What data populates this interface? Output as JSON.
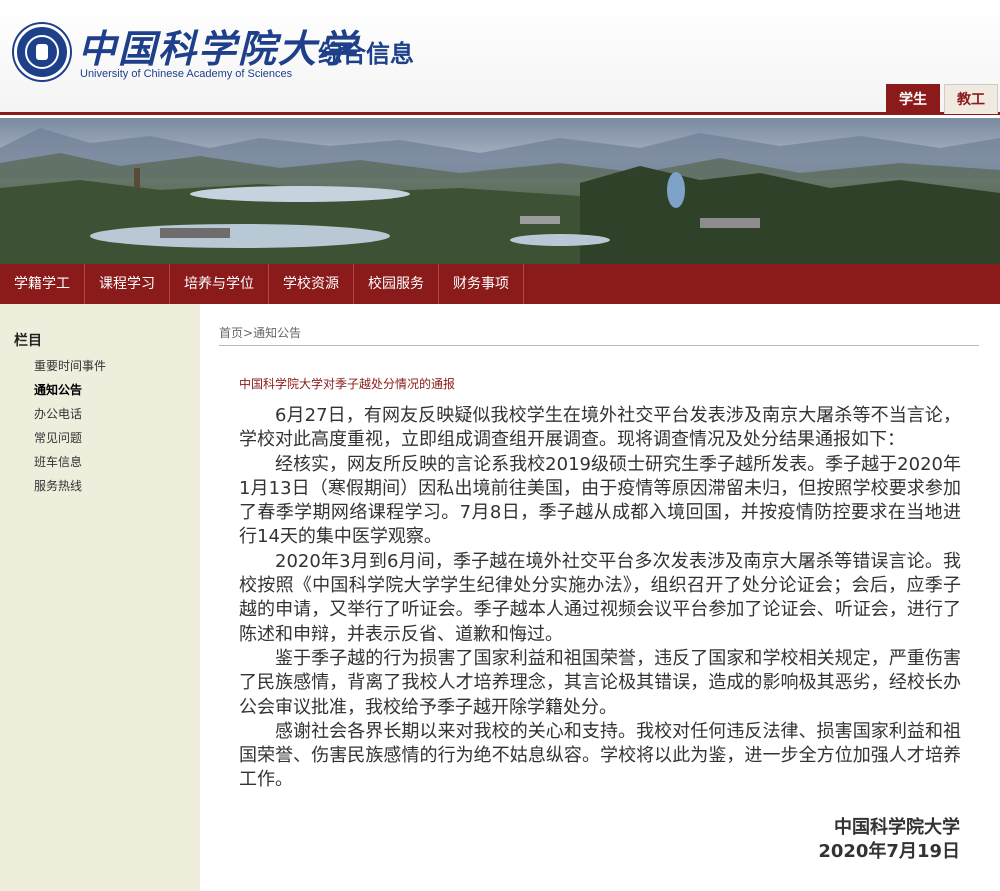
{
  "header": {
    "logo_cn": "中国科学院大学",
    "logo_en": "University of Chinese Academy of Sciences",
    "site_title": "综合信息",
    "role_tabs": [
      "学生",
      "教工"
    ]
  },
  "nav": {
    "items": [
      "学籍学工",
      "课程学习",
      "培养与学位",
      "学校资源",
      "校园服务",
      "财务事项"
    ]
  },
  "sidebar": {
    "title": "栏目",
    "items": [
      "重要时间事件",
      "通知公告",
      "办公电话",
      "常见问题",
      "班车信息",
      "服务热线"
    ],
    "current_item": "通知公告"
  },
  "breadcrumb": {
    "home": "首页",
    "separator": ">",
    "current": "通知公告"
  },
  "article": {
    "title": "中国科学院大学对季子越处分情况的通报",
    "paragraphs": [
      "6月27日，有网友反映疑似我校学生在境外社交平台发表涉及南京大屠杀等不当言论，学校对此高度重视，立即组成调查组开展调查。现将调查情况及处分结果通报如下：",
      "经核实，网友所反映的言论系我校2019级硕士研究生季子越所发表。季子越于2020年1月13日（寒假期间）因私出境前往美国，由于疫情等原因滞留未归，但按照学校要求参加了春季学期网络课程学习。7月8日，季子越从成都入境回国，并按疫情防控要求在当地进行14天的集中医学观察。",
      "2020年3月到6月间，季子越在境外社交平台多次发表涉及南京大屠杀等错误言论。我校按照《中国科学院大学学生纪律处分实施办法》，组织召开了处分论证会；会后，应季子越的申请，又举行了听证会。季子越本人通过视频会议平台参加了论证会、听证会，进行了陈述和申辩，并表示反省、道歉和悔过。",
      "鉴于季子越的行为损害了国家利益和祖国荣誉，违反了国家和学校相关规定，严重伤害了民族感情，背离了我校人才培养理念，其言论极其错误，造成的影响极其恶劣，经校长办公会审议批准，我校给予季子越开除学籍处分。",
      "感谢社会各界长期以来对我校的关心和支持。我校对任何违反法律、损害国家利益和祖国荣誉、伤害民族感情的行为绝不姑息纵容。学校将以此为鉴，进一步全方位加强人才培养工作。"
    ],
    "signature": "中国科学院大学",
    "date": "2020年7月19日"
  },
  "colors": {
    "brand_red": "#8b1a1a",
    "brand_blue": "#1e3f8a",
    "sidebar_bg": "#efeedd"
  }
}
